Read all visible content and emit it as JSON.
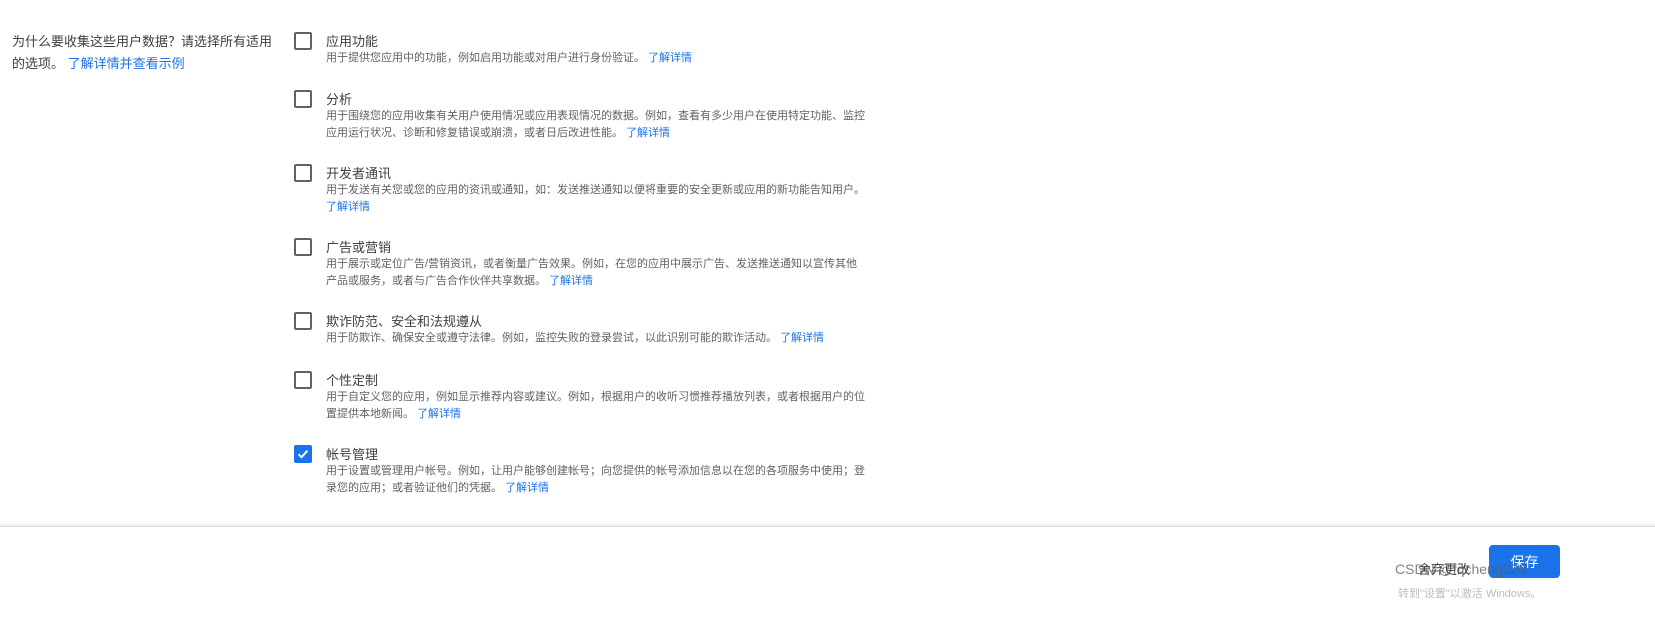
{
  "question": {
    "text": "为什么要收集这些用户数据？请选择所有适用的选项。",
    "link": "了解详情并查看示例"
  },
  "items": [
    {
      "title": "应用功能",
      "desc": "用于提供您应用中的功能，例如启用功能或对用户进行身份验证。",
      "link": "了解详情",
      "checked": false
    },
    {
      "title": "分析",
      "desc": "用于围绕您的应用收集有关用户使用情况或应用表现情况的数据。例如，查看有多少用户在使用特定功能、监控应用运行状况、诊断和修复错误或崩溃，或者日后改进性能。",
      "link": "了解详情",
      "checked": false
    },
    {
      "title": "开发者通讯",
      "desc": "用于发送有关您或您的应用的资讯或通知，如：发送推送通知以便将重要的安全更新或应用的新功能告知用户。",
      "link": "了解详情",
      "checked": false
    },
    {
      "title": "广告或营销",
      "desc": "用于展示或定位广告/营销资讯，或者衡量广告效果。例如，在您的应用中展示广告、发送推送通知以宣传其他产品或服务，或者与广告合作伙伴共享数据。",
      "link": "了解详情",
      "checked": false
    },
    {
      "title": "欺诈防范、安全和法规遵从",
      "desc": "用于防欺诈、确保安全或遵守法律。例如，监控失败的登录尝试，以此识别可能的欺诈活动。",
      "link": "了解详情",
      "checked": false
    },
    {
      "title": "个性定制",
      "desc": "用于自定义您的应用，例如显示推荐内容或建议。例如，根据用户的收听习惯推荐播放列表，或者根据用户的位置提供本地新闻。",
      "link": "了解详情",
      "checked": false
    },
    {
      "title": "帐号管理",
      "desc": "用于设置或管理用户帐号。例如，让用户能够创建帐号；向您提供的帐号添加信息以在您的各项服务中使用；登录您的应用；或者验证他们的凭据。",
      "link": "了解详情",
      "checked": true
    }
  ],
  "footer": {
    "discard": "舍弃更改",
    "save": "保存"
  },
  "watermark": {
    "csdn": "CSDN @fqcheng220",
    "windows": "转到\"设置\"以激活 Windows。"
  },
  "colors": {
    "accent": "#1a73e8"
  }
}
